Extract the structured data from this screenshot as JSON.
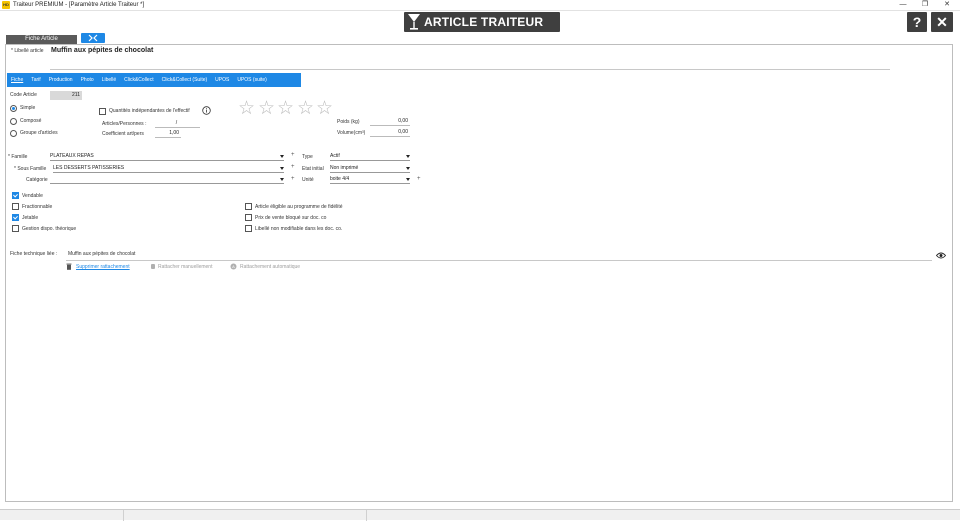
{
  "window": {
    "app_logo_text": "HD",
    "title": "Traiteur PREMIUM - [Paramètre Article Traiteur *]",
    "minimize_glyph": "—",
    "restore_glyph": "❐",
    "close_glyph": "✕"
  },
  "header": {
    "title": "ARTICLE TRAITEUR",
    "help_glyph": "?",
    "close_glyph": "✕"
  },
  "toolbar": {
    "fiche_article_label": "Fiche Article",
    "collapse_glyph": "⤫"
  },
  "libelle": {
    "label": "* Libellé article",
    "value": "Muffin aux pépites de chocolat"
  },
  "tabs": [
    {
      "label": "Fiche",
      "active": true
    },
    {
      "label": "Tarif",
      "active": false
    },
    {
      "label": "Production",
      "active": false
    },
    {
      "label": "Photo",
      "active": false
    },
    {
      "label": "Libellé",
      "active": false
    },
    {
      "label": "Click&Collect",
      "active": false
    },
    {
      "label": "Click&Collect (Suite)",
      "active": false
    },
    {
      "label": "UPOS",
      "active": false
    },
    {
      "label": "UPOS (suite)",
      "active": false
    }
  ],
  "fiche": {
    "code_article_label": "Code Article",
    "code_article_value": "211",
    "type_options": [
      {
        "label": "Simple",
        "selected": true
      },
      {
        "label": "Composé",
        "selected": false
      },
      {
        "label": "Groupe d'articles",
        "selected": false
      }
    ],
    "quantites_label": "Quantités indépendantes de l'effectif",
    "quantites_checked": false,
    "articles_personnes_label": "Articles/Personnes :",
    "articles_personnes_value": "/",
    "coefficient_label": "Coefficient art/pers",
    "coefficient_value": "1,00",
    "rating": 0,
    "rating_max": 5,
    "poids_label": "Poids (kg)",
    "poids_value": "0,00",
    "volume_label": "Volume(cm³)",
    "volume_value": "0,00",
    "famille_label": "* Famille",
    "famille_value": "PLATEAUX REPAS",
    "sous_famille_label": "* Sous Famille",
    "sous_famille_value": "LES DESSERTS PATISSERIES",
    "categorie_label": "Catégorie",
    "categorie_value": "",
    "type_label": "Type",
    "type_value": "Actif",
    "etat_label": "Etat initial",
    "etat_value": "Non imprimé",
    "unite_label": "Unité",
    "unite_value": "boite 4/4",
    "plus_glyph": "+",
    "left_checks": [
      {
        "label": "Vendable",
        "checked": true
      },
      {
        "label": "Fractionnable",
        "checked": false
      },
      {
        "label": "Jetable",
        "checked": true
      },
      {
        "label": "Gestion dispo. théorique",
        "checked": false
      }
    ],
    "right_checks": [
      {
        "label": "Article éligible au programme de fidélité",
        "checked": false
      },
      {
        "label": "Prix de vente bloqué sur doc. co",
        "checked": false
      },
      {
        "label": "Libellé non modifiable dans les doc. co.",
        "checked": false
      }
    ],
    "fiche_technique_label": "Fiche technique liée :",
    "fiche_technique_value": "Muffin aux pépites de chocolat",
    "supprimer_label": "Supprimer rattachement",
    "rattacher_manuel_label": "Rattacher manuellement",
    "rattachement_auto_label": "Rattachement automatique"
  },
  "colors": {
    "accent": "#1e88e5",
    "header_bg": "#3f3f3f",
    "disabled_text": "#9e9e9e"
  }
}
